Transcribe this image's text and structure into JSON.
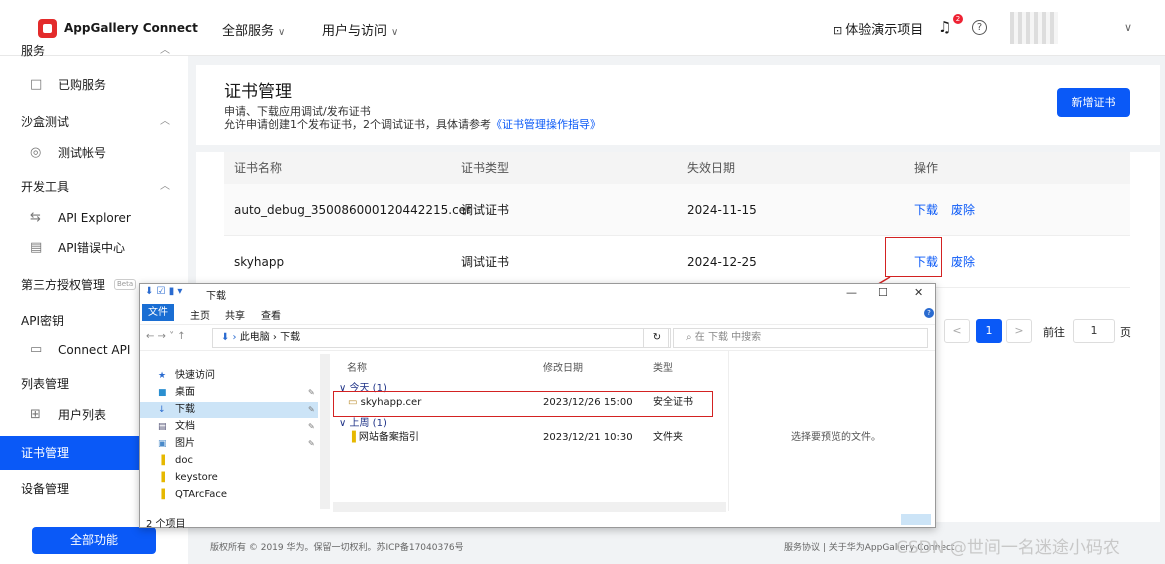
{
  "topbar": {
    "brand": "AppGallery Connect",
    "nav": [
      "全部服务",
      "用户与访问"
    ],
    "demo": "体验演示项目",
    "badge": "2",
    "help": "?",
    "chevron": "﹀"
  },
  "sidebar": {
    "items": [
      {
        "label": "服务",
        "type": "group"
      },
      {
        "label": "已购服务",
        "icon": "□"
      },
      {
        "label": "沙盒测试",
        "type": "group"
      },
      {
        "label": "测试帐号",
        "icon": "◎"
      },
      {
        "label": "开发工具",
        "type": "group"
      },
      {
        "label": "API Explorer",
        "icon": "⇆"
      },
      {
        "label": "API错误中心",
        "icon": "▤"
      },
      {
        "label": "第三方授权管理",
        "tag": "Beta",
        "type": "group"
      },
      {
        "label": "API密钥",
        "type": "group"
      },
      {
        "label": "Connect API",
        "icon": "▭"
      },
      {
        "label": "列表管理",
        "type": "group"
      },
      {
        "label": "用户列表",
        "icon": "⊞"
      },
      {
        "label": "证书管理",
        "type": "active"
      },
      {
        "label": "设备管理",
        "type": "group"
      }
    ],
    "all_button": "全部功能"
  },
  "header": {
    "title": "证书管理",
    "desc1": "申请、下载应用调试/发布证书",
    "desc2_prefix": "允许申请创建1个发布证书，2个调试证书，具体请参考",
    "desc2_link": "《证书管理操作指导》",
    "new_button": "新增证书"
  },
  "table": {
    "columns": [
      "证书名称",
      "证书类型",
      "失效日期",
      "操作"
    ],
    "rows": [
      {
        "name": "auto_debug_350086000120442215.cer",
        "type": "调试证书",
        "expiry": "2024-11-15",
        "download": "下载",
        "revoke": "废除"
      },
      {
        "name": "skyhapp",
        "type": "调试证书",
        "expiry": "2024-12-25",
        "download": "下载",
        "revoke": "废除"
      }
    ]
  },
  "pagination": {
    "prev": "<",
    "current": "1",
    "next": ">",
    "goto": "前往",
    "page_input": "1",
    "page_word": "页"
  },
  "footer": {
    "copyright": "版权所有 © 2019 华为。保留一切权利。苏ICP备17040376号",
    "links": "服务协议 | 关于华为AppGallery Connect",
    "watermark": "CSDN @世间一名迷途小码农"
  },
  "explorer": {
    "title": "下载",
    "ribbon_tabs": [
      "文件",
      "主页",
      "共享",
      "查看"
    ],
    "path": "此电脑 › 下载",
    "search_placeholder": "在 下载 中搜索",
    "nav_items": [
      {
        "label": "快速访问",
        "icon": "★",
        "pin": ""
      },
      {
        "label": "桌面",
        "icon": "■",
        "pin": "✎"
      },
      {
        "label": "下载",
        "icon": "↓",
        "pin": "✎"
      },
      {
        "label": "文档",
        "icon": "▤",
        "pin": "✎"
      },
      {
        "label": "图片",
        "icon": "▣",
        "pin": "✎"
      },
      {
        "label": "doc",
        "icon": "▐",
        "pin": ""
      },
      {
        "label": "keystore",
        "icon": "▐",
        "pin": ""
      },
      {
        "label": "QTArcFace",
        "icon": "▐",
        "pin": ""
      }
    ],
    "col_headers": [
      "名称",
      "修改日期",
      "类型"
    ],
    "groups": [
      {
        "label": "今天 (1)",
        "files": [
          {
            "name": "skyhapp.cer",
            "date": "2023/12/26 15:00",
            "type": "安全证书",
            "icon": "▭"
          }
        ]
      },
      {
        "label": "上周 (1)",
        "files": [
          {
            "name": "网站备案指引",
            "date": "2023/12/21 10:30",
            "type": "文件夹",
            "icon": "▐"
          }
        ]
      }
    ],
    "preview_text": "选择要预览的文件。",
    "status": "2 个项目",
    "window_buttons": [
      "—",
      "☐",
      "✕"
    ]
  }
}
